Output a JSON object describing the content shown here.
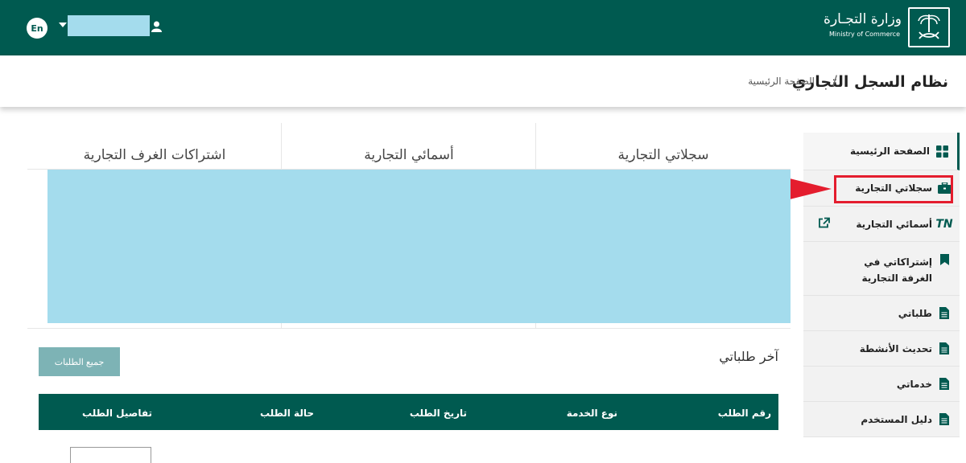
{
  "header": {
    "ministry_ar": "وزارة التجـارة",
    "ministry_en": "Ministry of Commerce",
    "lang_button": "En",
    "user_name": ""
  },
  "titlebar": {
    "title": "نظام السجل التجاري",
    "separator": "/",
    "breadcrumb_home": "الصفحة الرئيسية"
  },
  "sidebar": {
    "items": [
      {
        "label": "الصفحة الرئيسية",
        "icon": "grid-icon"
      },
      {
        "label": "سجلاتي التجارية",
        "icon": "briefcase-icon"
      },
      {
        "label": "أسمائي التجارية",
        "icon": "tn-icon",
        "icon_text": "TN",
        "extra_icon": "external-link-icon"
      },
      {
        "label": "إشتراكاتي في الغرفة التجارية",
        "icon": "bookmark-icon"
      },
      {
        "label": "طلباتي",
        "icon": "file-icon"
      },
      {
        "label": "تحديث الأنشطة",
        "icon": "file-icon"
      },
      {
        "label": "خدماتي",
        "icon": "file-icon"
      },
      {
        "label": "دليل المستخدم",
        "icon": "file-icon"
      }
    ]
  },
  "tabs": [
    "سجلاتي التجارية",
    "أسمائي التجارية",
    "اشتراكات الغرف التجارية"
  ],
  "recent_requests": {
    "title": "آخر طلباتي",
    "all_button": "جميع الطلبات",
    "columns": [
      "رقم الطلب",
      "نوع الخدمة",
      "تاريخ الطلب",
      "حالة الطلب",
      "تفاصيل الطلب"
    ]
  },
  "colors": {
    "brand": "#005a50",
    "highlight": "#e41d2e",
    "redaction": "#a4dced"
  }
}
